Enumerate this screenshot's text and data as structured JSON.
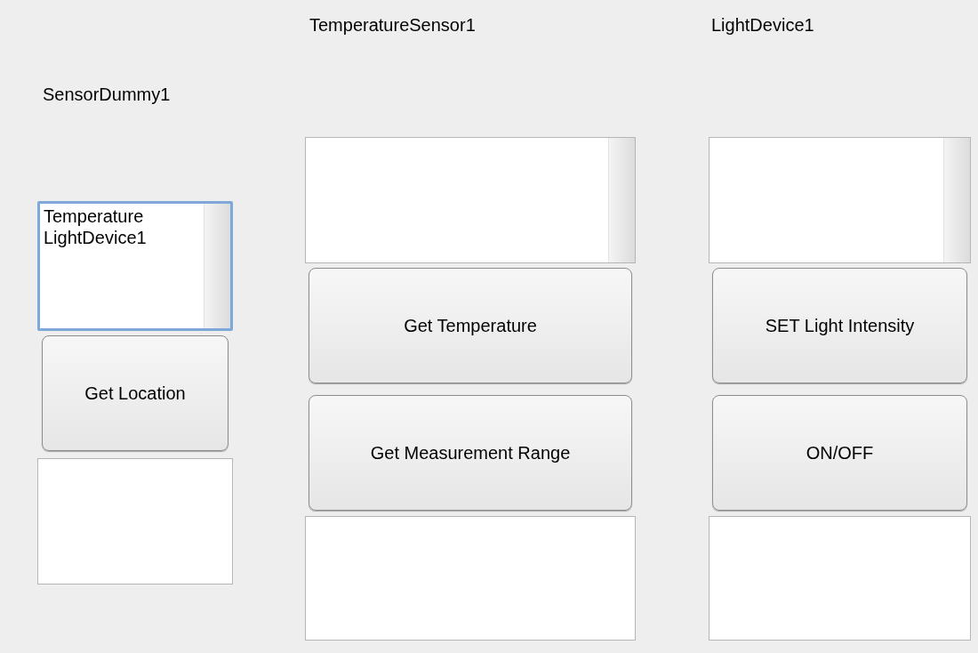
{
  "panels": [
    {
      "title": "SensorDummy1",
      "list": {
        "focused": true,
        "items": [
          "Temperature",
          "LightDevice1"
        ]
      },
      "buttons": [
        "Get Location"
      ]
    },
    {
      "title": "TemperatureSensor1",
      "list": {
        "focused": false
      },
      "buttons": [
        "Get Temperature",
        "Get Measurement Range"
      ]
    },
    {
      "title": "LightDevice1",
      "list": {
        "focused": false
      },
      "buttons": [
        "SET Light Intensity",
        "ON/OFF"
      ]
    }
  ]
}
